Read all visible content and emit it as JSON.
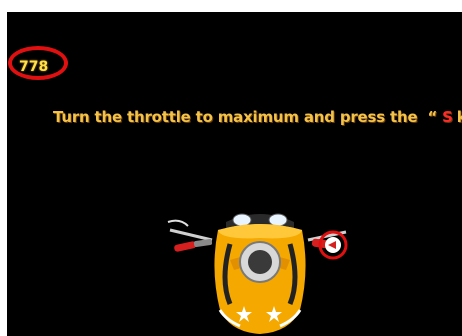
{
  "hud": {
    "counter_value": "778"
  },
  "instruction": {
    "text": "Turn the throttle to maximum and press the",
    "open_quote": "“",
    "key_letter": "S",
    "key_word": "key",
    "close_quote": "”"
  },
  "colors": {
    "background": "#000000",
    "counter_text": "#ffe04a",
    "counter_ring": "#e01010",
    "instruction_text": "#f2c24a",
    "key_letter": "#ff2a2a",
    "bike_body": "#f5a800"
  },
  "icons": {
    "vehicle": "motorcycle-handlebar-icon",
    "throttle_highlight": "throttle-grip-icon"
  }
}
